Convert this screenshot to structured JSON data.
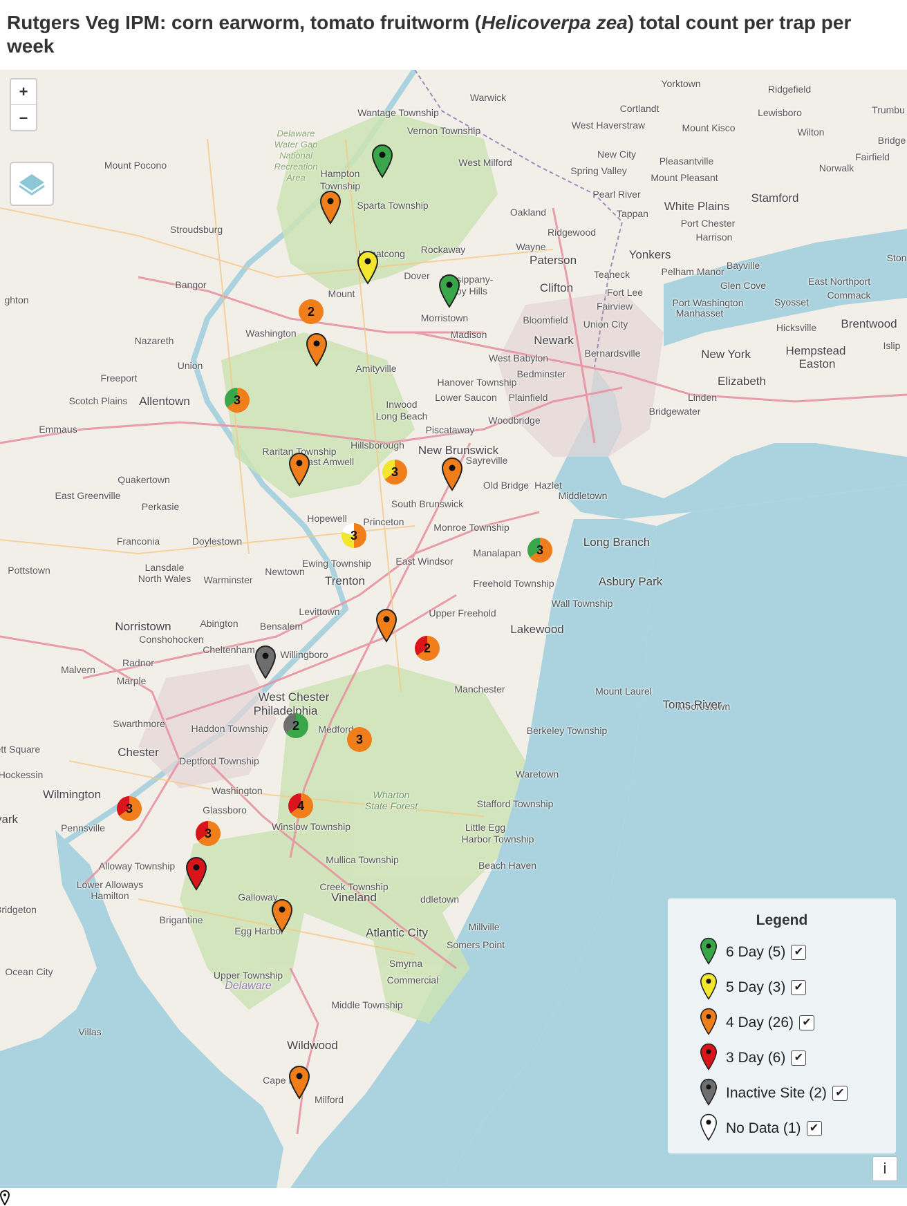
{
  "title": {
    "prefix": "Rutgers Veg IPM: corn earworm, tomato fruitworm (",
    "species": "Helicoverpa zea",
    "suffix": ") total count per trap per week"
  },
  "map_controls": {
    "zoom_in": "+",
    "zoom_out": "–",
    "layers_icon": "layers-icon",
    "info": "i"
  },
  "colors": {
    "green": "#3aa64a",
    "yellow": "#f2e62e",
    "orange": "#f07e1a",
    "red": "#d9141a",
    "gray": "#6e6e6e",
    "white": "#ffffff",
    "water": "#aad3df",
    "land": "#f2efe9",
    "forest": "#cde3b4"
  },
  "places": [
    {
      "name": "Yorktown",
      "kind": "normal"
    },
    {
      "name": "Ridgefield",
      "kind": "normal"
    },
    {
      "name": "Warwick",
      "kind": "normal"
    },
    {
      "name": "Cortlandt",
      "kind": "normal"
    },
    {
      "name": "Lewisboro",
      "kind": "normal"
    },
    {
      "name": "Trumbu",
      "kind": "normal"
    },
    {
      "name": "Wantage Township",
      "kind": "normal"
    },
    {
      "name": "West Haverstraw",
      "kind": "normal"
    },
    {
      "name": "Mount Kisco",
      "kind": "normal"
    },
    {
      "name": "Wilton",
      "kind": "normal"
    },
    {
      "name": "Vernon Township",
      "kind": "normal"
    },
    {
      "name": "Bridge",
      "kind": "normal"
    },
    {
      "name": "Delaware",
      "kind": "dw"
    },
    {
      "name": "Water Gap",
      "kind": "dw"
    },
    {
      "name": "National",
      "kind": "dw"
    },
    {
      "name": "Recreation",
      "kind": "dw"
    },
    {
      "name": "Area",
      "kind": "dw"
    },
    {
      "name": "New City",
      "kind": "normal"
    },
    {
      "name": "Pleasantville",
      "kind": "normal"
    },
    {
      "name": "Fairfield",
      "kind": "normal"
    },
    {
      "name": "West Milford",
      "kind": "normal"
    },
    {
      "name": "Norwalk",
      "kind": "normal"
    },
    {
      "name": "Mount Pocono",
      "kind": "normal"
    },
    {
      "name": "Hampton",
      "kind": "normal"
    },
    {
      "name": "Township",
      "kind": "normal"
    },
    {
      "name": "Spring Valley",
      "kind": "normal"
    },
    {
      "name": "Mount Pleasant",
      "kind": "normal"
    },
    {
      "name": "Pearl River",
      "kind": "normal"
    },
    {
      "name": "Sparta Township",
      "kind": "normal"
    },
    {
      "name": "White Plains",
      "kind": "big"
    },
    {
      "name": "Stamford",
      "kind": "big"
    },
    {
      "name": "Oakland",
      "kind": "normal"
    },
    {
      "name": "Tappan",
      "kind": "normal"
    },
    {
      "name": "Port Chester",
      "kind": "normal"
    },
    {
      "name": "Stroudsburg",
      "kind": "normal"
    },
    {
      "name": "Ridgewood",
      "kind": "normal"
    },
    {
      "name": "Harrison",
      "kind": "normal"
    },
    {
      "name": "Wayne",
      "kind": "normal"
    },
    {
      "name": "Rockaway",
      "kind": "normal"
    },
    {
      "name": "Hopatcong",
      "kind": "normal"
    },
    {
      "name": "Paterson",
      "kind": "big"
    },
    {
      "name": "Yonkers",
      "kind": "big"
    },
    {
      "name": "Ston",
      "kind": "normal"
    },
    {
      "name": "Teaneck",
      "kind": "normal"
    },
    {
      "name": "Pelham Manor",
      "kind": "normal"
    },
    {
      "name": "Bayville",
      "kind": "normal"
    },
    {
      "name": "Dover",
      "kind": "normal"
    },
    {
      "name": "Parsippany-",
      "kind": "normal"
    },
    {
      "name": "Troy Hills",
      "kind": "normal"
    },
    {
      "name": "Bangor",
      "kind": "normal"
    },
    {
      "name": "Clifton",
      "kind": "big"
    },
    {
      "name": "Fort Lee",
      "kind": "normal"
    },
    {
      "name": "Glen Cove",
      "kind": "normal"
    },
    {
      "name": "East Northport",
      "kind": "normal"
    },
    {
      "name": "Mount",
      "kind": "normal"
    },
    {
      "name": "Commack",
      "kind": "normal"
    },
    {
      "name": "ghton",
      "kind": "normal"
    },
    {
      "name": "Fairview",
      "kind": "normal"
    },
    {
      "name": "Port Washington",
      "kind": "normal"
    },
    {
      "name": "Syosset",
      "kind": "normal"
    },
    {
      "name": "Manhasset",
      "kind": "normal"
    },
    {
      "name": "Morristown",
      "kind": "normal"
    },
    {
      "name": "Bloomfield",
      "kind": "normal"
    },
    {
      "name": "Brentwood",
      "kind": "big"
    },
    {
      "name": "Union City",
      "kind": "normal"
    },
    {
      "name": "Hicksville",
      "kind": "normal"
    },
    {
      "name": "Madison",
      "kind": "normal"
    },
    {
      "name": "Washington",
      "kind": "normal"
    },
    {
      "name": "Nazareth",
      "kind": "normal"
    },
    {
      "name": "Newark",
      "kind": "big"
    },
    {
      "name": "Islip",
      "kind": "normal"
    },
    {
      "name": "Bernardsville",
      "kind": "normal"
    },
    {
      "name": "New York",
      "kind": "big"
    },
    {
      "name": "Hempstead",
      "kind": "big"
    },
    {
      "name": "West Babylon",
      "kind": "normal"
    },
    {
      "name": "Union",
      "kind": "normal"
    },
    {
      "name": "Easton",
      "kind": "big"
    },
    {
      "name": "Amityville",
      "kind": "normal"
    },
    {
      "name": "Bedminster",
      "kind": "normal"
    },
    {
      "name": "Elizabeth",
      "kind": "big"
    },
    {
      "name": "Freeport",
      "kind": "normal"
    },
    {
      "name": "Hanover Township",
      "kind": "normal"
    },
    {
      "name": "Scotch Plains",
      "kind": "normal"
    },
    {
      "name": "Allentown",
      "kind": "big"
    },
    {
      "name": "Lower Saucon",
      "kind": "normal"
    },
    {
      "name": "Plainfield",
      "kind": "normal"
    },
    {
      "name": "Linden",
      "kind": "normal"
    },
    {
      "name": "Inwood",
      "kind": "normal"
    },
    {
      "name": "Bridgewater",
      "kind": "normal"
    },
    {
      "name": "Long Beach",
      "kind": "normal"
    },
    {
      "name": "Emmaus",
      "kind": "normal"
    },
    {
      "name": "Woodbridge",
      "kind": "normal"
    },
    {
      "name": "Piscataway",
      "kind": "normal"
    },
    {
      "name": "Raritan Township",
      "kind": "normal"
    },
    {
      "name": "Hillsborough",
      "kind": "normal"
    },
    {
      "name": "New Brunswick",
      "kind": "big"
    },
    {
      "name": "Sayreville",
      "kind": "normal"
    },
    {
      "name": "East Amwell",
      "kind": "normal"
    },
    {
      "name": "Quakertown",
      "kind": "normal"
    },
    {
      "name": "Old Bridge",
      "kind": "normal"
    },
    {
      "name": "Hazlet",
      "kind": "normal"
    },
    {
      "name": "East Greenville",
      "kind": "normal"
    },
    {
      "name": "Middletown",
      "kind": "normal"
    },
    {
      "name": "Perkasie",
      "kind": "normal"
    },
    {
      "name": "South Brunswick",
      "kind": "normal"
    },
    {
      "name": "Hopewell",
      "kind": "normal"
    },
    {
      "name": "Princeton",
      "kind": "normal"
    },
    {
      "name": "Monroe Township",
      "kind": "normal"
    },
    {
      "name": "Franconia",
      "kind": "normal"
    },
    {
      "name": "Doylestown",
      "kind": "normal"
    },
    {
      "name": "Long Branch",
      "kind": "big"
    },
    {
      "name": "Manalapan",
      "kind": "normal"
    },
    {
      "name": "Pottstown",
      "kind": "normal"
    },
    {
      "name": "Lansdale",
      "kind": "normal"
    },
    {
      "name": "Ewing Township",
      "kind": "normal"
    },
    {
      "name": "East Windsor",
      "kind": "normal"
    },
    {
      "name": "North Wales",
      "kind": "normal"
    },
    {
      "name": "Warminster",
      "kind": "normal"
    },
    {
      "name": "Newtown",
      "kind": "normal"
    },
    {
      "name": "Trenton",
      "kind": "big"
    },
    {
      "name": "Freehold Township",
      "kind": "normal"
    },
    {
      "name": "Asbury Park",
      "kind": "big"
    },
    {
      "name": "Wall Township",
      "kind": "normal"
    },
    {
      "name": "Levittown",
      "kind": "normal"
    },
    {
      "name": "Upper Freehold",
      "kind": "normal"
    },
    {
      "name": "Abington",
      "kind": "normal"
    },
    {
      "name": "Norristown",
      "kind": "big"
    },
    {
      "name": "Bensalem",
      "kind": "normal"
    },
    {
      "name": "Lakewood",
      "kind": "big"
    },
    {
      "name": "Conshohocken",
      "kind": "normal"
    },
    {
      "name": "Cheltenham",
      "kind": "normal"
    },
    {
      "name": "Radnor",
      "kind": "normal"
    },
    {
      "name": "Willingboro",
      "kind": "normal"
    },
    {
      "name": "Malvern",
      "kind": "normal"
    },
    {
      "name": "Manchester",
      "kind": "normal"
    },
    {
      "name": "Marple",
      "kind": "normal"
    },
    {
      "name": "West Chester",
      "kind": "big"
    },
    {
      "name": "Moorestown",
      "kind": "normal"
    },
    {
      "name": "Philadelphia",
      "kind": "big"
    },
    {
      "name": "Toms River",
      "kind": "big"
    },
    {
      "name": "Mount Laurel",
      "kind": "normal"
    },
    {
      "name": "Swarthmore",
      "kind": "normal"
    },
    {
      "name": "Haddon Township",
      "kind": "normal"
    },
    {
      "name": "Medford",
      "kind": "normal"
    },
    {
      "name": "Berkeley Township",
      "kind": "normal"
    },
    {
      "name": "Chester",
      "kind": "big"
    },
    {
      "name": "nett Square",
      "kind": "normal"
    },
    {
      "name": "Deptford Township",
      "kind": "normal"
    },
    {
      "name": "Hockessin",
      "kind": "normal"
    },
    {
      "name": "Waretown",
      "kind": "normal"
    },
    {
      "name": "Washington",
      "kind": "normal"
    },
    {
      "name": "Wilmington",
      "kind": "big"
    },
    {
      "name": "Wharton",
      "kind": "wf"
    },
    {
      "name": "State Forest",
      "kind": "wf"
    },
    {
      "name": "Glassboro",
      "kind": "normal"
    },
    {
      "name": "Stafford Township",
      "kind": "normal"
    },
    {
      "name": "vark",
      "kind": "big"
    },
    {
      "name": "Pennsville",
      "kind": "normal"
    },
    {
      "name": "Winslow Township",
      "kind": "normal"
    },
    {
      "name": "Little Egg",
      "kind": "normal"
    },
    {
      "name": "Harbor Township",
      "kind": "normal"
    },
    {
      "name": "Mullica Township",
      "kind": "normal"
    },
    {
      "name": "Alloway Township",
      "kind": "normal"
    },
    {
      "name": "Beach Haven",
      "kind": "normal"
    },
    {
      "name": "Lower Alloways",
      "kind": "normal"
    },
    {
      "name": "Creek Township",
      "kind": "normal"
    },
    {
      "name": "Hamilton",
      "kind": "normal"
    },
    {
      "name": "Vineland",
      "kind": "big"
    },
    {
      "name": "Galloway",
      "kind": "normal"
    },
    {
      "name": "ddletown",
      "kind": "normal"
    },
    {
      "name": "Bridgeton",
      "kind": "normal"
    },
    {
      "name": "Brigantine",
      "kind": "normal"
    },
    {
      "name": "Millville",
      "kind": "normal"
    },
    {
      "name": "Egg Harbor",
      "kind": "normal"
    },
    {
      "name": "Atlantic City",
      "kind": "big"
    },
    {
      "name": "Somers Point",
      "kind": "normal"
    },
    {
      "name": "Smyrna",
      "kind": "normal"
    },
    {
      "name": "Ocean City",
      "kind": "normal"
    },
    {
      "name": "Commercial",
      "kind": "normal"
    },
    {
      "name": "Upper Township",
      "kind": "normal"
    },
    {
      "name": "Delaware",
      "kind": "de"
    },
    {
      "name": "Middle Township",
      "kind": "normal"
    },
    {
      "name": "Villas",
      "kind": "normal"
    },
    {
      "name": "Wildwood",
      "kind": "big"
    },
    {
      "name": "Cape May",
      "kind": "normal"
    },
    {
      "name": "Milford",
      "kind": "normal"
    }
  ],
  "pins": [
    {
      "category": "6 Day",
      "color": "green"
    },
    {
      "category": "4 Day",
      "color": "orange"
    },
    {
      "category": "5 Day",
      "color": "yellow"
    },
    {
      "category": "6 Day",
      "color": "green"
    },
    {
      "category": "4 Day",
      "color": "orange"
    },
    {
      "category": "4 Day",
      "color": "orange"
    },
    {
      "category": "4 Day",
      "color": "orange"
    },
    {
      "category": "4 Day",
      "color": "orange"
    },
    {
      "category": "Inactive Site",
      "color": "gray"
    },
    {
      "category": "3 Day",
      "color": "red"
    },
    {
      "category": "4 Day",
      "color": "orange"
    },
    {
      "category": "4 Day",
      "color": "orange"
    }
  ],
  "clusters": [
    {
      "count": "2",
      "segments": [
        "orange"
      ]
    },
    {
      "count": "3",
      "segments": [
        "orange",
        "green"
      ]
    },
    {
      "count": "3",
      "segments": [
        "orange",
        "yellow"
      ]
    },
    {
      "count": "3",
      "segments": [
        "orange",
        "yellow",
        "white"
      ]
    },
    {
      "count": "3",
      "segments": [
        "orange",
        "green"
      ]
    },
    {
      "count": "2",
      "segments": [
        "orange",
        "red"
      ]
    },
    {
      "count": "2",
      "segments": [
        "green",
        "gray"
      ]
    },
    {
      "count": "3",
      "segments": [
        "orange"
      ]
    },
    {
      "count": "3",
      "segments": [
        "orange",
        "red"
      ]
    },
    {
      "count": "4",
      "segments": [
        "orange",
        "red"
      ]
    },
    {
      "count": "3",
      "segments": [
        "orange",
        "red"
      ]
    }
  ],
  "legend": {
    "title": "Legend",
    "items": [
      {
        "label": "6 Day (5)",
        "color": "green",
        "checked": "✔"
      },
      {
        "label": "5 Day (3)",
        "color": "yellow",
        "checked": "✔"
      },
      {
        "label": "4 Day (26)",
        "color": "orange",
        "checked": "✔"
      },
      {
        "label": "3 Day (6)",
        "color": "red",
        "checked": "✔"
      },
      {
        "label": "Inactive Site (2)",
        "color": "gray",
        "checked": "✔"
      },
      {
        "label": "No Data (1)",
        "color": "white",
        "checked": "✔"
      }
    ]
  }
}
